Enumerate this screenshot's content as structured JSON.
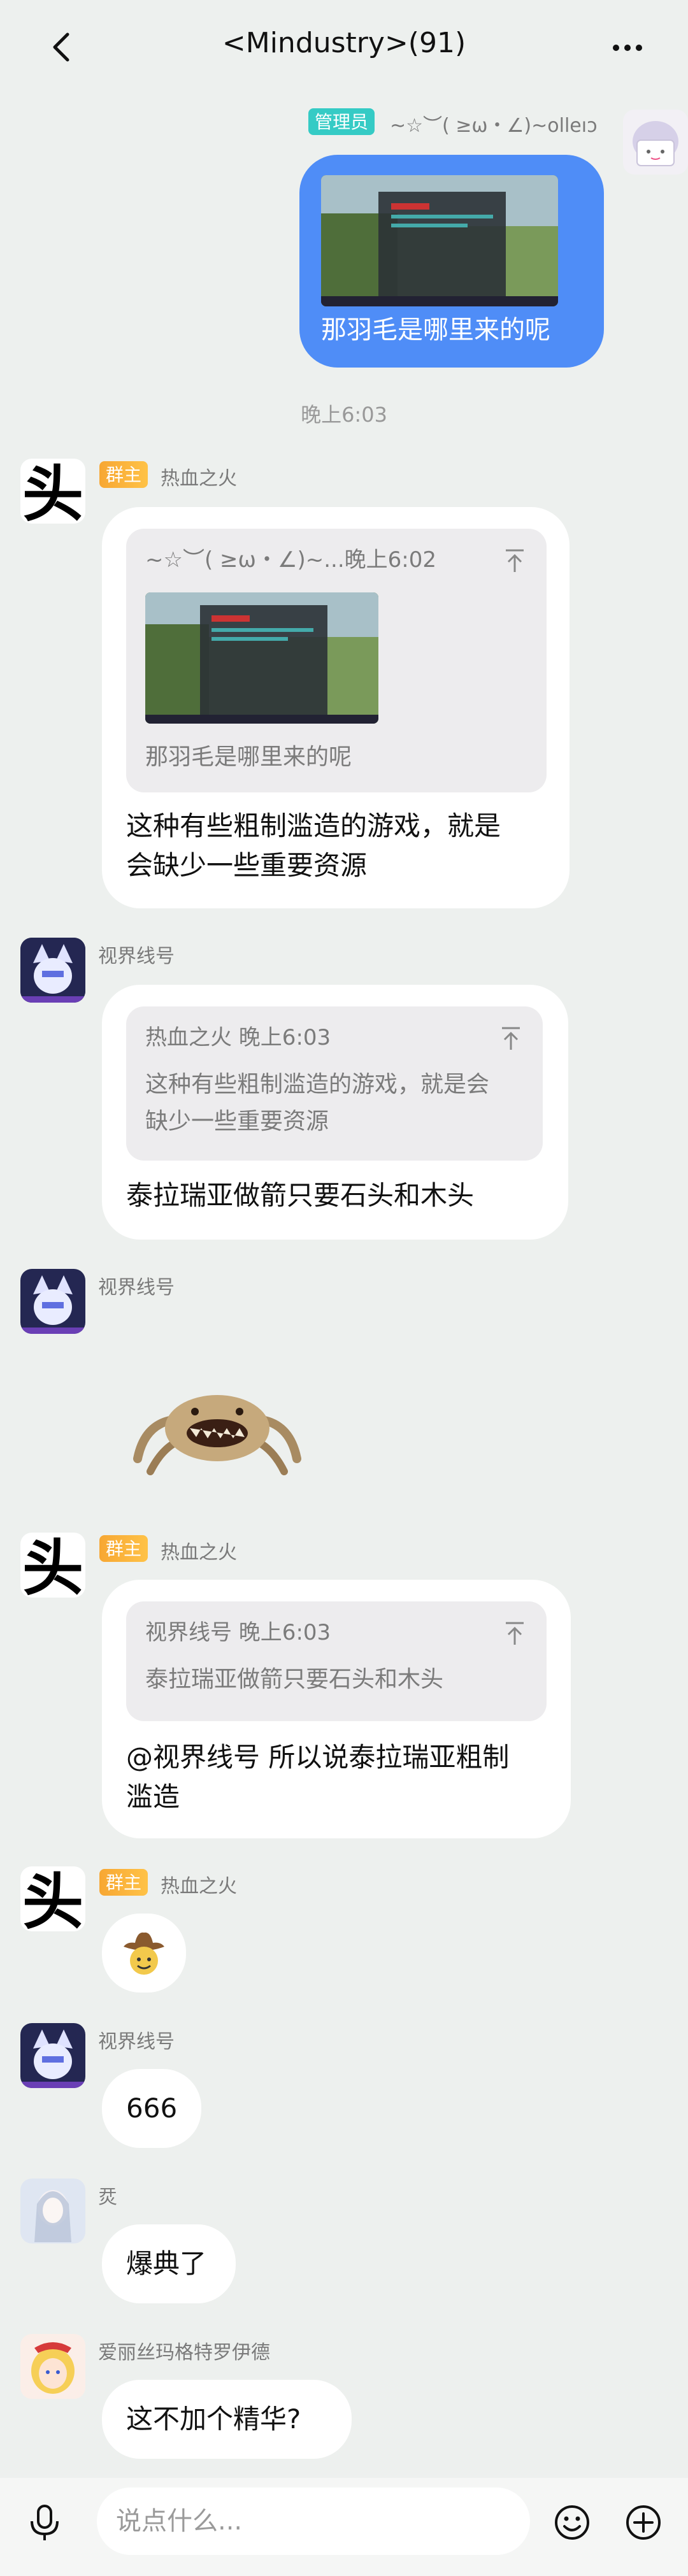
{
  "header": {
    "title": "<Mindustry>(91)"
  },
  "timestamp": "晚上6:03",
  "messages": [
    {
      "sender": "~☆︶( ≥ω・∠)~olleıɔ",
      "role": "管理员",
      "text": "那羽毛是哪里来的呢"
    },
    {
      "sender": "热血之火",
      "role": "群主",
      "quote": {
        "author": "~☆︶( ≥ω・∠)~...晚上6:02",
        "text": "那羽毛是哪里来的呢"
      },
      "text_line1": "这种有些粗制滥造的游戏，就是",
      "text_line2": "会缺少一些重要资源"
    },
    {
      "sender": "视界线号",
      "quote": {
        "author": "热血之火 晚上6:03",
        "line1": "这种有些粗制滥造的游戏，就是会",
        "line2": "缺少一些重要资源"
      },
      "text": "泰拉瑞亚做箭只要石头和木头"
    },
    {
      "sender": "视界线号",
      "sticker": "spider-creature-sticker"
    },
    {
      "sender": "热血之火",
      "role": "群主",
      "quote": {
        "author": "视界线号 晚上6:03",
        "text": "泰拉瑞亚做箭只要石头和木头"
      },
      "text_line1": "@视界线号 所以说泰拉瑞亚粗制",
      "text_line2": "滥造"
    },
    {
      "sender": "热血之火",
      "role": "群主",
      "emoji": "cowboy-emoji"
    },
    {
      "sender": "视界线号",
      "text": "666"
    },
    {
      "sender": "烎",
      "text": "爆典了"
    },
    {
      "sender": "爱丽丝玛格特罗伊德",
      "text": "这不加个精华?"
    }
  ],
  "avatar_text": "头",
  "input": {
    "placeholder": "说点什么..."
  },
  "colors": {
    "background": "#EDF0EE",
    "self_bubble": "#4F8DF7",
    "owner_badge": "#F7A733",
    "admin_badge": "#35CBC5"
  }
}
